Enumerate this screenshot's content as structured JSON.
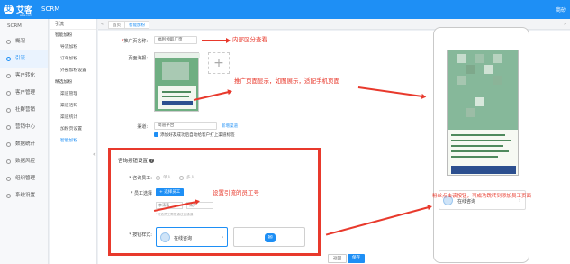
{
  "header": {
    "logo_mark": "艾",
    "logo_text": "艾客",
    "logo_sub": "aike.com",
    "app_title": "SCRM",
    "user": "商砂"
  },
  "sidebar1": {
    "title": "SCRM",
    "items": [
      {
        "label": "概况"
      },
      {
        "label": "引流"
      },
      {
        "label": "客户转化"
      },
      {
        "label": "客户管理"
      },
      {
        "label": "社群营销"
      },
      {
        "label": "营销中心"
      },
      {
        "label": "数据统计"
      },
      {
        "label": "数据风控"
      },
      {
        "label": "组织管理"
      },
      {
        "label": "系统设置"
      }
    ]
  },
  "sidebar2": {
    "title": "引流",
    "group1": "智能加粉",
    "items1": [
      "导流加粉",
      "订单加粉",
      "外部加粉设置"
    ],
    "group2": "精选加粉",
    "items2": [
      "渠道管理",
      "渠道活码",
      "渠道统计",
      "加粉页设置",
      "智能加粉"
    ],
    "toggle": "«"
  },
  "tabs": {
    "prev": "«",
    "home": "首页",
    "current": "智能加粉",
    "next": "»"
  },
  "form": {
    "page_name_label": "推广页名称:",
    "page_name_value": "福利领取广页",
    "page_image_label": "页面海报:",
    "upload_plus": "+",
    "channel_label": "渠道:",
    "channel_value": "简道平台",
    "channel_link": "新增渠道",
    "checkbox_label": "添加好友成功后自动给客户打上渠道标签"
  },
  "section": {
    "title": "咨询按钮设置",
    "q": "?",
    "staff_label": "* 咨询员工:",
    "radio1": "单人",
    "radio2": "多人",
    "staff_select_label": "* 员工选择",
    "select_btn": "+ 选择员工",
    "staff1": "李涛涛",
    "staff2": "涛升",
    "hint": "*可选员工需是通过且通通",
    "style_label": "* 按钮样式:",
    "card_text": "在线咨询",
    "card_chev": "›",
    "msg_icon": "✉"
  },
  "footer": {
    "cancel": "返回",
    "submit": "保存"
  },
  "annotations": {
    "a1": "内部区分查看",
    "a2": "推广页面显示，如图展示，适配手机页面",
    "a3": "设置引流的员工号",
    "a4": "粉丝点击该按钮，可成功跳转到添加员工页面"
  },
  "phone": {
    "card_text": "在线咨询",
    "card_chev": "›"
  },
  "colors": {
    "accent": "#1e8ff5",
    "annotation": "#e8392c"
  }
}
